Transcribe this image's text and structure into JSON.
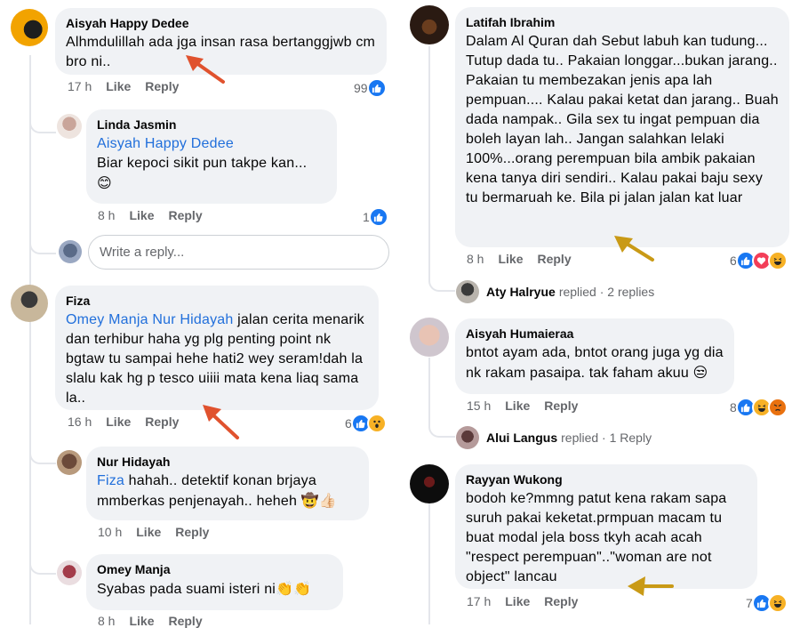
{
  "left": {
    "c1": {
      "author": "Aisyah Happy Dedee",
      "text": "Alhmdulillah ada jga insan rasa bertanggjwb cm bro ni..",
      "time": "17 h",
      "like": "Like",
      "reply": "Reply",
      "count": "99"
    },
    "r1": {
      "author": "Linda Jasmin",
      "mention": "Aisyah Happy Dedee",
      "text": "Biar kepoci sikit pun takpe kan...",
      "emoji": "😊",
      "time": "8 h",
      "like": "Like",
      "reply": "Reply",
      "count": "1"
    },
    "write": {
      "placeholder": "Write a reply..."
    },
    "c2": {
      "author": "Fiza",
      "mention": "Omey Manja Nur Hidayah",
      "text": " jalan cerita menarik dan terhibur haha yg plg penting point nk bgtaw tu sampai hehe hati2 wey seram!dah la slalu kak hg p tesco uiiii mata kena liaq sama la..",
      "time": "16 h",
      "like": "Like",
      "reply": "Reply",
      "count": "6"
    },
    "r2": {
      "author": "Nur Hidayah",
      "mention": "Fiza",
      "text": " hahah.. detektif konan brjaya mmberkas penjenayah.. heheh",
      "emoji": "🤠👍🏻",
      "time": "10 h",
      "like": "Like",
      "reply": "Reply"
    },
    "r3": {
      "author": "Omey Manja",
      "text": "Syabas pada suami isteri ni",
      "emoji": "👏👏",
      "time": "8 h",
      "like": "Like",
      "reply": "Reply"
    }
  },
  "right": {
    "c1": {
      "author": "Latifah Ibrahim",
      "text": "Dalam Al Quran dah Sebut labuh kan tudung... Tutup dada tu.. Pakaian longgar...bukan jarang.. Pakaian tu membezakan  jenis apa lah pempuan.... Kalau pakai ketat dan jarang.. Buah dada nampak.. Gila sex tu ingat pempuan dia boleh layan lah.. Jangan salahkan lelaki 100%...orang perempuan bila ambik pakaian kena tanya diri sendiri.. Kalau pakai baju sexy tu bermaruah ke. Bila pi jalan jalan kat luar",
      "time": "8 h",
      "like": "Like",
      "reply": "Reply",
      "count": "6"
    },
    "rep1": {
      "name": "Aty Halryue",
      "verb": "replied",
      "dot": "·",
      "count": "2 replies"
    },
    "c2": {
      "author": "Aisyah Humaieraa",
      "text": "bntot ayam ada, bntot orang juga yg dia nk rakam pasaipa. tak faham akuu",
      "emoji": "😒",
      "time": "15 h",
      "like": "Like",
      "reply": "Reply",
      "count": "8"
    },
    "rep2": {
      "name": "Alui Langus",
      "verb": "replied",
      "dot": "·",
      "count": "1 Reply"
    },
    "c3": {
      "author": "Rayyan Wukong",
      "text": "bodoh ke?mmng patut kena rakam sapa suruh pakai keketat.prmpuan macam tu buat modal jela boss tkyh acah acah \"respect perempuan\"..\"woman are not object\" lancau",
      "time": "17 h",
      "like": "Like",
      "reply": "Reply",
      "count": "7"
    }
  },
  "colors": {
    "like_blue": "#1877f2",
    "love_red": "#f33e58",
    "haha_yellow": "#f7b125",
    "arrow_red": "#e0522e",
    "arrow_gold": "#c99a16",
    "bubble": "#f0f2f5"
  },
  "icons": [
    "like-icon",
    "love-icon",
    "haha-icon",
    "wow-icon",
    "angry-icon",
    "arrow-annotation"
  ]
}
